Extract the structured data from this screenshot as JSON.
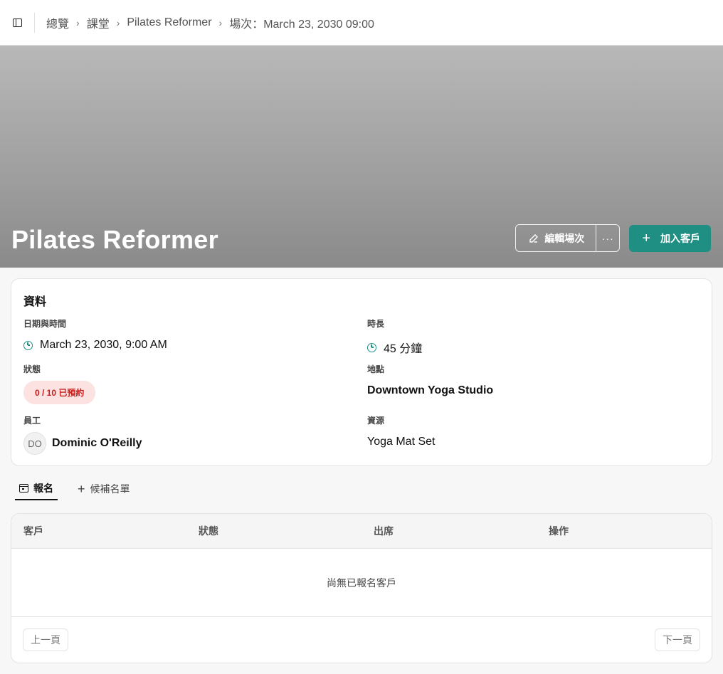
{
  "breadcrumb": [
    "總覽",
    "課堂",
    "Pilates Reformer",
    "場次：March 23, 2030 09:00"
  ],
  "hero": {
    "title": "Pilates Reformer",
    "edit_label": "編輯場次",
    "more_label": "···",
    "add_client_label": "加入客戶"
  },
  "info": {
    "heading": "資料",
    "datetime_label": "日期與時間",
    "datetime_value": "March 23, 2030, 9:00 AM",
    "duration_label": "時長",
    "duration_value": "45 分鐘",
    "status_label": "狀態",
    "status_value": "0 / 10 已預約",
    "location_label": "地點",
    "location_value": "Downtown Yoga Studio",
    "staff_label": "員工",
    "staff_initials": "DO",
    "staff_name": "Dominic O'Reilly",
    "resource_label": "資源",
    "resource_value": "Yoga Mat Set"
  },
  "tabs": [
    {
      "label": "報名",
      "icon": "calendar-icon",
      "active": true
    },
    {
      "label": "候補名單",
      "icon": "plus-icon",
      "active": false
    }
  ],
  "table": {
    "columns": [
      "客戶",
      "狀態",
      "出席",
      "操作"
    ],
    "empty_text": "尚無已報名客戶",
    "prev_label": "上一頁",
    "next_label": "下一頁"
  },
  "colors": {
    "accent": "#1f8f84",
    "badge_bg": "#fde2e2",
    "badge_text": "#c81e1e"
  }
}
